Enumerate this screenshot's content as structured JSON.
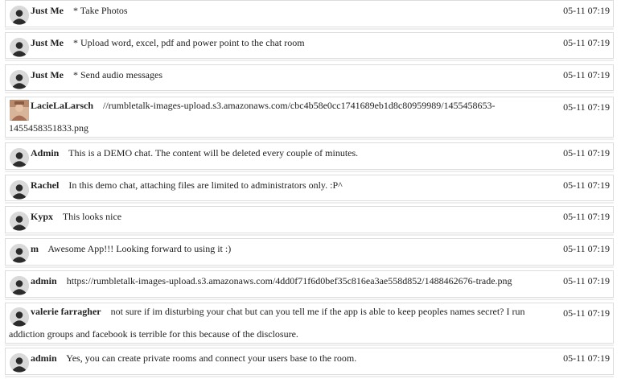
{
  "messages": [
    {
      "name": "Just Me",
      "text": "* Take Photos",
      "time": "05-11 07:19",
      "avatar": "default-avatar-icon"
    },
    {
      "name": "Just Me",
      "text": "* Upload word, excel, pdf and power point to the chat room",
      "time": "05-11 07:19",
      "avatar": "default-avatar-icon"
    },
    {
      "name": "Just Me",
      "text": "* Send audio messages",
      "time": "05-11 07:19",
      "avatar": "default-avatar-icon"
    },
    {
      "name": "LacieLaLarsch",
      "text": "//rumbletalk-images-upload.s3.amazonaws.com/cbc4b58e0cc1741689eb1d8c80959989/1455458653-1455458351833.png",
      "time": "05-11 07:19",
      "avatar": "user-photo"
    },
    {
      "name": "Admin",
      "text": "This is a DEMO chat. The content will be deleted every couple of minutes.",
      "time": "05-11 07:19",
      "avatar": "default-avatar-icon"
    },
    {
      "name": "Rachel",
      "text": "In this demo chat, attaching files are limited to administrators only. :P^",
      "time": "05-11 07:19",
      "avatar": "default-avatar-icon"
    },
    {
      "name": "Kypx",
      "text": "This looks nice",
      "time": "05-11 07:19",
      "avatar": "default-avatar-icon"
    },
    {
      "name": "m",
      "text": "Awesome App!!! Looking forward to using it :)",
      "time": "05-11 07:19",
      "avatar": "default-avatar-icon"
    },
    {
      "name": "admin",
      "text": "https://rumbletalk-images-upload.s3.amazonaws.com/4dd0f71f6d0bef35c816ea3ae558d852/1488462676-trade.png",
      "time": "05-11 07:19",
      "avatar": "default-avatar-icon"
    },
    {
      "name": "valerie farragher",
      "text": "not sure if im disturbing your chat but can you tell me if the app is able to keep peoples names secret? I run addiction groups and facebook is terrible for this because of the disclosure.",
      "time": "05-11 07:19",
      "avatar": "default-avatar-icon"
    },
    {
      "name": "admin",
      "text": "Yes, you can create private rooms and connect your users base to the room.",
      "time": "05-11 07:19",
      "avatar": "default-avatar-icon"
    }
  ]
}
